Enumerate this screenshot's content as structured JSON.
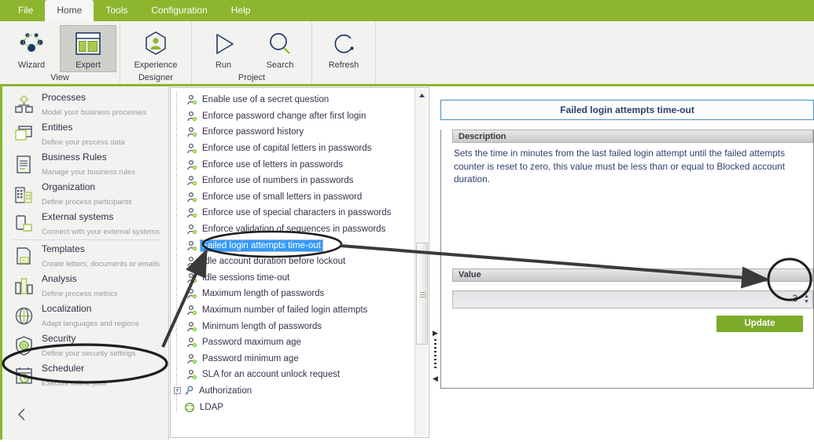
{
  "colors": {
    "brand_green": "#8DB52E",
    "button_green": "#7DAB29",
    "selection_blue": "#3399FF",
    "title_border_blue": "#4A90C4",
    "title_text": "#2E3F6E",
    "ribbon_bg": "#F2F2F0",
    "sidebar_bg": "#F2F2F0"
  },
  "menubar": {
    "items": [
      {
        "label": "File",
        "active": false
      },
      {
        "label": "Home",
        "active": true
      },
      {
        "label": "Tools",
        "active": false
      },
      {
        "label": "Configuration",
        "active": false
      },
      {
        "label": "Help",
        "active": false
      }
    ]
  },
  "ribbon": {
    "groups": [
      {
        "label": "View",
        "buttons": [
          {
            "label": "Wizard",
            "icon": "network-nodes-icon",
            "selected": false
          },
          {
            "label": "Expert",
            "icon": "layout-panels-icon",
            "selected": true
          }
        ]
      },
      {
        "label": "Designer",
        "buttons": [
          {
            "label": "Experience",
            "icon": "user-hexagon-icon",
            "selected": false
          }
        ]
      },
      {
        "label": "Project",
        "buttons": [
          {
            "label": "Run",
            "icon": "play-triangle-icon",
            "selected": false
          },
          {
            "label": "Search",
            "icon": "magnifier-icon",
            "selected": false
          }
        ]
      },
      {
        "label": "",
        "buttons": [
          {
            "label": "Refresh",
            "icon": "refresh-circular-arrow-icon",
            "selected": false
          }
        ]
      }
    ]
  },
  "sidebar": {
    "items": [
      {
        "title": "Processes",
        "subtitle": "Model your business processes",
        "icon": "process-flow-icon",
        "highlighted": false
      },
      {
        "title": "Entities",
        "subtitle": "Define your process data",
        "icon": "entities-windows-icon",
        "highlighted": false
      },
      {
        "title": "Business Rules",
        "subtitle": "Manage your business rules",
        "icon": "document-rules-icon",
        "highlighted": false
      },
      {
        "title": "Organization",
        "subtitle": "Define process participants",
        "icon": "building-icon",
        "highlighted": false
      },
      {
        "title": "External systems",
        "subtitle": "Connect with your external systems",
        "icon": "external-device-icon",
        "highlighted": false
      },
      {
        "title": "Templates",
        "subtitle": "Create letters, documents  or emails",
        "icon": "template-page-icon",
        "highlighted": false
      },
      {
        "title": "Analysis",
        "subtitle": "Define  process  metrics",
        "icon": "bar-chart-icon",
        "highlighted": false
      },
      {
        "title": "Localization",
        "subtitle": "Adapt  languages and regions",
        "icon": "globe-icon",
        "highlighted": false
      },
      {
        "title": "Security",
        "subtitle": "Define  your  security  settings",
        "icon": "shield-gear-icon",
        "highlighted": true
      },
      {
        "title": "Scheduler",
        "subtitle": "Execute offline  jobs",
        "icon": "calendar-clock-icon",
        "highlighted": false
      }
    ],
    "collapse_icon": "chevron-left-icon"
  },
  "tree": {
    "items": [
      {
        "label": "Enable use of a secret question",
        "icon": "user-gear-icon",
        "selected": false,
        "level": 1
      },
      {
        "label": "Enforce password change after first login",
        "icon": "user-gear-icon",
        "selected": false,
        "level": 1
      },
      {
        "label": "Enforce password history",
        "icon": "user-gear-icon",
        "selected": false,
        "level": 1
      },
      {
        "label": "Enforce use of capital letters in passwords",
        "icon": "user-gear-icon",
        "selected": false,
        "level": 1
      },
      {
        "label": "Enforce use of letters in passwords",
        "icon": "user-gear-icon",
        "selected": false,
        "level": 1
      },
      {
        "label": "Enforce use of numbers in passwords",
        "icon": "user-gear-icon",
        "selected": false,
        "level": 1
      },
      {
        "label": "Enforce use of small letters in password",
        "icon": "user-gear-icon",
        "selected": false,
        "level": 1
      },
      {
        "label": "Enforce use of special characters in passwords",
        "icon": "user-gear-icon",
        "selected": false,
        "level": 1
      },
      {
        "label": "Enforce validation of sequences in passwords",
        "icon": "user-gear-icon",
        "selected": false,
        "level": 1
      },
      {
        "label": "Failed login attempts time-out",
        "icon": "user-gear-icon",
        "selected": true,
        "level": 1
      },
      {
        "label": "Idle account duration before lockout",
        "icon": "user-gear-icon",
        "selected": false,
        "level": 1
      },
      {
        "label": "Idle sessions time-out",
        "icon": "user-gear-icon",
        "selected": false,
        "level": 1
      },
      {
        "label": "Maximum length of passwords",
        "icon": "user-gear-icon",
        "selected": false,
        "level": 1
      },
      {
        "label": "Maximum number of failed login attempts",
        "icon": "user-gear-icon",
        "selected": false,
        "level": 1
      },
      {
        "label": "Minimum length of passwords",
        "icon": "user-gear-icon",
        "selected": false,
        "level": 1
      },
      {
        "label": "Password maximum age",
        "icon": "user-gear-icon",
        "selected": false,
        "level": 1
      },
      {
        "label": "Password minimum age",
        "icon": "user-gear-icon",
        "selected": false,
        "level": 1
      },
      {
        "label": "SLA for an account unlock request",
        "icon": "user-gear-icon",
        "selected": false,
        "level": 1
      },
      {
        "label": "Authorization",
        "icon": "key-icon",
        "selected": false,
        "level": 0,
        "expander": "+"
      },
      {
        "label": "LDAP",
        "icon": "ldap-circle-icon",
        "selected": false,
        "level": 0
      }
    ]
  },
  "detail": {
    "title": "Failed login attempts time-out",
    "description_header": "Description",
    "description": "Sets the time in minutes from the last failed login attempt until the failed attempts counter is reset to zero, this value must be less than or equal to Blocked account duration.",
    "value_header": "Value",
    "value": "3",
    "update_label": "Update"
  },
  "annotations": {
    "security_ellipse": "callout-ellipse-security",
    "tree_item_ellipse": "callout-ellipse-tree-item",
    "value_ellipse": "callout-ellipse-value",
    "arrow_security_to_tree": "callout-arrow-1",
    "arrow_tree_to_value": "callout-arrow-2"
  }
}
